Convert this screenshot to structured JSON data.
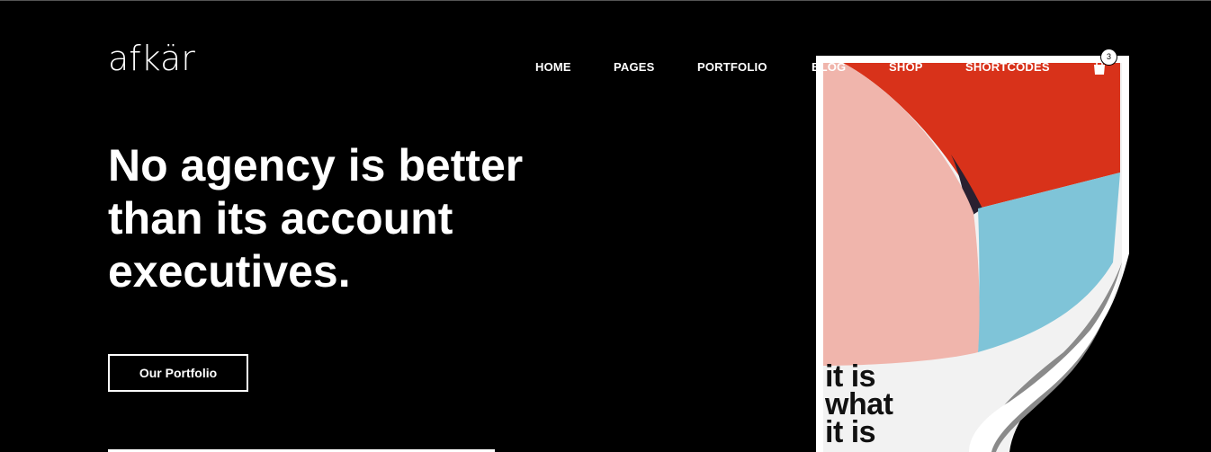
{
  "brand": {
    "logo_text": "afkär"
  },
  "nav": {
    "items": [
      {
        "label": "HOME"
      },
      {
        "label": "PAGES"
      },
      {
        "label": "PORTFOLIO"
      },
      {
        "label": "BLOG"
      },
      {
        "label": "SHOP"
      },
      {
        "label": "SHORTCODES"
      }
    ]
  },
  "cart": {
    "count": "3",
    "icon": "shopping-bag-icon"
  },
  "hero": {
    "headline_lines": [
      "No agency is better",
      "than its account",
      "executives."
    ],
    "cta_label": "Our Portfolio"
  },
  "poster": {
    "text_lines": [
      "it is",
      "what",
      "it is"
    ],
    "colors": {
      "red": "#d8321a",
      "pink": "#f0b5ac",
      "blue": "#7fc4d8",
      "paper": "#f2f2f2",
      "curl": "#8a8a8a"
    }
  },
  "colors": {
    "background": "#000000",
    "text": "#ffffff"
  }
}
